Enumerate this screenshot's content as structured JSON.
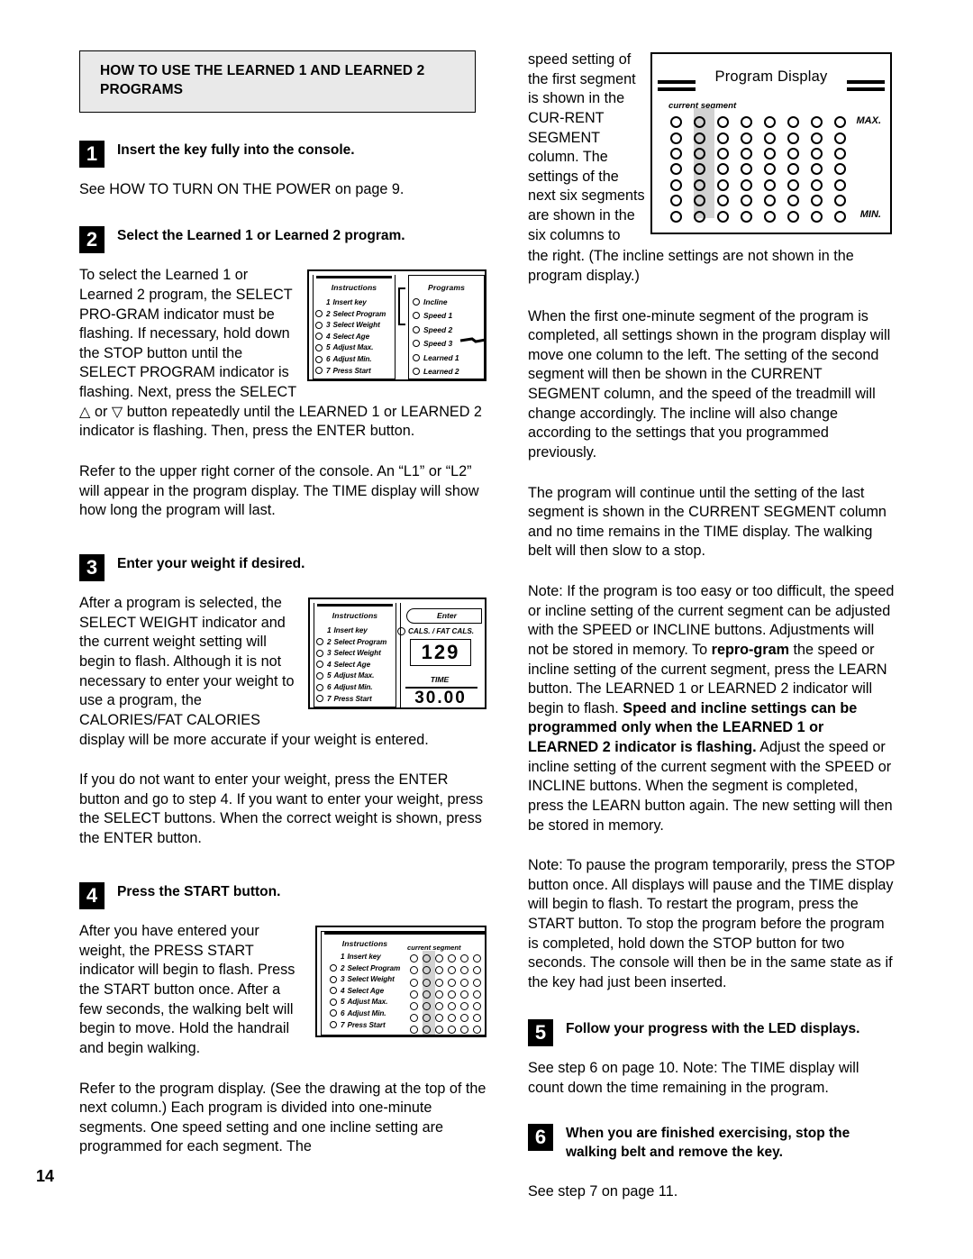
{
  "page": {
    "number": "14"
  },
  "section": {
    "heading": "HOW TO USE THE LEARNED 1 AND LEARNED 2 PROGRAMS"
  },
  "steps": [
    {
      "num": "1",
      "title": "Insert the key fully into the console.",
      "body": "See HOW TO TURN ON THE POWER on page 9."
    },
    {
      "num": "2",
      "title": "Select the Learned 1 or Learned 2 program.",
      "body1": "To select the Learned 1 or Learned 2 program, the SELECT PRO-GRAM indicator must be flashing. If necessary, hold down the STOP button until the SELECT PROGRAM indicator is flashing. Next, press the SELECT △ or ▽ button repeatedly until the LEARNED 1 or LEARNED 2 indicator is flashing. Then, press the ENTER button.",
      "body2": "Refer to the upper right corner of the console. An “L1” or “L2” will appear in the program display. The TIME display will show how long the program will last."
    },
    {
      "num": "3",
      "title": "Enter your weight if desired.",
      "body1": "After a program is selected, the SELECT WEIGHT indicator and the current weight setting will begin to flash. Although it is not necessary to enter your weight to use a program, the CALORIES/FAT CALORIES display will be more accurate if your weight is entered.",
      "body2": "If you do not want to enter your weight, press the ENTER button and go to step 4. If you want to enter your weight, press the SELECT buttons. When the correct weight is shown, press the ENTER button."
    },
    {
      "num": "4",
      "title": "Press the START button.",
      "body1": "After you have entered your weight, the PRESS START indicator will begin to flash. Press the START button once. After a few seconds, the walking belt will begin to move. Hold the handrail and begin walking.",
      "body2": "Refer to the program display. (See the drawing at the top of the next column.) Each program is divided into one-minute segments. One speed setting and one incline setting are programmed for each segment. The"
    },
    {
      "num": "5",
      "title": "Follow your progress with the LED displays.",
      "body": "See step 6 on page 10. Note: The TIME display will count down the time remaining in the program."
    },
    {
      "num": "6",
      "title": "When you are finished exercising, stop the walking belt and remove the key.",
      "body": "See step 7 on page 11."
    }
  ],
  "right_column": {
    "para_top": "speed setting of the first segment is shown in the CUR-RENT SEGMENT column. The settings of the next six segments are shown in the six columns to",
    "para_top_cont": "the right. (The incline settings are not shown in the program display.)",
    "para2": "When the first one-minute segment of the program is completed, all settings shown in the program display will move one column to the left. The setting of the second segment will then be shown in the CURRENT SEGMENT column, and the speed of the treadmill will change accordingly. The incline will also change according to the settings that you programmed previously.",
    "para3": "The program will continue until the setting of the last segment is shown in the CURRENT SEGMENT column and no time remains in the TIME display. The walking belt will then slow to a stop.",
    "note1_a": "Note: If the program is too easy or too difficult, the speed or incline setting of the current segment can be adjusted with the SPEED or INCLINE buttons. Adjustments will not be stored in memory. To ",
    "note1_b1": "repro-gram",
    "note1_c": " the speed or incline setting of the current segment, press the LEARN button. The LEARNED 1 or LEARNED 2 indicator will begin to flash. ",
    "note1_b2": "Speed and incline settings can be programmed only when the LEARNED 1 or LEARNED 2 indicator is flashing.",
    "note1_d": " Adjust the speed or incline setting of the current segment with the SPEED or INCLINE buttons. When the segment is completed, press the LEARN button again. The new setting will then be stored in memory.",
    "note2": "Note: To pause the program temporarily, press the STOP button once. All displays will pause and the TIME display will begin to flash. To restart the program, press the START button. To stop the program before the program is completed, hold down the STOP button for two seconds. The console will then be in the same state as if the key had just been inserted."
  },
  "program_display": {
    "title": "Program Display",
    "current_segment_label": "current segment",
    "max_label": "MAX.",
    "min_label": "MIN.",
    "columns": 8,
    "rows": 7,
    "highlight_column": 2
  },
  "console_figure": {
    "instructions_title": "Instructions",
    "instructions": [
      {
        "n": "1",
        "label": "Insert key",
        "led": false
      },
      {
        "n": "2",
        "label": "Select Program",
        "led": true
      },
      {
        "n": "3",
        "label": "Select Weight",
        "led": true
      },
      {
        "n": "4",
        "label": "Select Age",
        "led": true
      },
      {
        "n": "5",
        "label": "Adjust Max.",
        "led": true
      },
      {
        "n": "6",
        "label": "Adjust Min.",
        "led": true
      },
      {
        "n": "7",
        "label": "Press Start",
        "led": true
      }
    ],
    "programs_title": "Programs",
    "programs": [
      "Incline",
      "Speed 1",
      "Speed 2",
      "Speed 3",
      "Learned 1",
      "Learned 2"
    ],
    "enter_label": "Enter",
    "cals_label": "CALS. / FAT CALS.",
    "cals_value": "129",
    "time_label": "TIME",
    "time_value": "30.00",
    "current_segment_label": "current segment"
  }
}
